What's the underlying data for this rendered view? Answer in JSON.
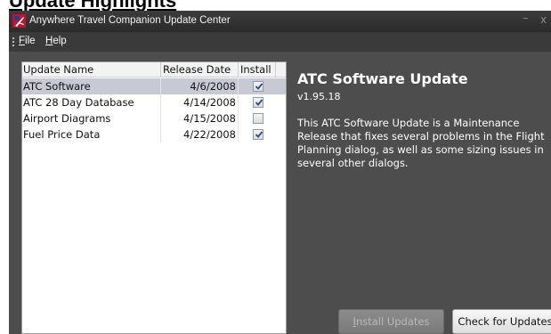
{
  "page_heading": "Update Highlights",
  "window": {
    "title": "Anywhere Travel Companion Update Center",
    "minimize_glyph": "–",
    "close_glyph": "x",
    "icon": "travel-app-icon"
  },
  "menu": {
    "items": [
      {
        "label": "File",
        "accel": "F"
      },
      {
        "label": "Help",
        "accel": "H"
      }
    ]
  },
  "update_list": {
    "columns": [
      "Update Name",
      "Release Date",
      "Install"
    ],
    "rows": [
      {
        "name": "ATC Software",
        "date": "4/6/2008",
        "install": true,
        "selected": true
      },
      {
        "name": "ATC 28 Day Database",
        "date": "4/14/2008",
        "install": true,
        "selected": false
      },
      {
        "name": "Airport Diagrams",
        "date": "4/15/2008",
        "install": false,
        "selected": false
      },
      {
        "name": "Fuel Price Data",
        "date": "4/22/2008",
        "install": true,
        "selected": false
      }
    ]
  },
  "details": {
    "title": "ATC Software Update",
    "version": "v1.95.18",
    "description": "This ATC Software Update is a Maintenance Release that fixes several problems in the Flight Planning dialog, as well as some sizing issues in several other dialogs."
  },
  "buttons": {
    "install": {
      "label": "Install Updates",
      "enabled": false
    },
    "check": {
      "label": "Check for Updates",
      "enabled": true
    }
  },
  "colors": {
    "window_bg": "#4d4d4d",
    "titlebar_bg": "#333333",
    "selected_row": "#c9c9d6",
    "text_on_dark": "#ffffff"
  }
}
